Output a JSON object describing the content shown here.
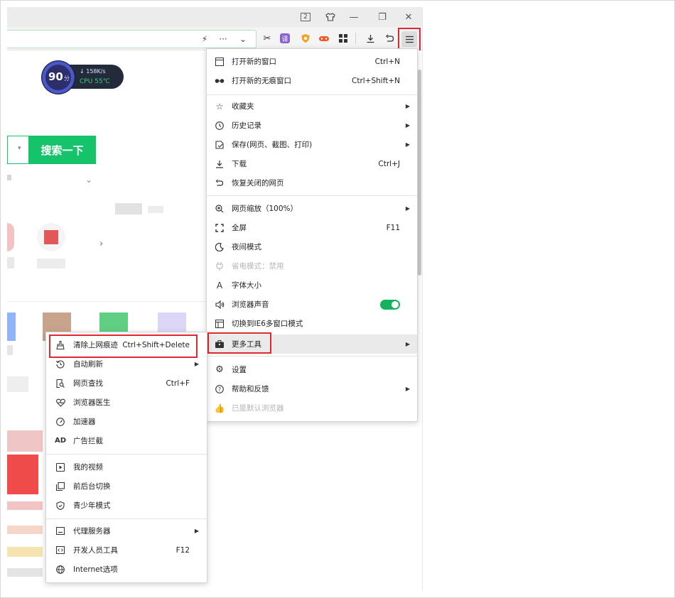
{
  "titlebar": {
    "tab_count": "2",
    "skin_icon": "tshirt-icon",
    "minimize_label": "—",
    "restore_label": "❐",
    "close_label": "✕"
  },
  "address_bar": {
    "bolt_icon": "⚡",
    "more_icon": "···",
    "chevron_icon": "⌄"
  },
  "toolbar_icons": {
    "translate_label": "译"
  },
  "widget": {
    "score": "90",
    "score_unit": "分",
    "speed": "↓ 158K/s",
    "cpu": "CPU 55℃"
  },
  "search": {
    "button_label": "搜索一下"
  },
  "main_menu": {
    "items": [
      {
        "label": "打开新的窗口",
        "shortcut": "Ctrl+N",
        "icon": "new-window-icon"
      },
      {
        "label": "打开新的无痕窗口",
        "shortcut": "Ctrl+Shift+N",
        "icon": "incognito-icon"
      },
      {
        "label": "收藏夹",
        "icon": "star-list-icon"
      },
      {
        "label": "历史记录",
        "icon": "clock-icon"
      },
      {
        "label": "保存(网页、截图、打印)",
        "icon": "save-icon"
      },
      {
        "label": "下载",
        "shortcut": "Ctrl+J",
        "icon": "download-icon"
      },
      {
        "label": "恢复关闭的网页",
        "icon": "undo-icon"
      },
      {
        "label": "网页缩放（100%）",
        "icon": "zoom-icon"
      },
      {
        "label": "全屏",
        "shortcut": "F11",
        "icon": "fullscreen-icon"
      },
      {
        "label": "夜间模式",
        "icon": "moon-icon"
      },
      {
        "label": "省电模式：禁用",
        "icon": "plug-icon"
      },
      {
        "label": "字体大小",
        "icon": "font-icon"
      },
      {
        "label": "浏览器声音",
        "icon": "speaker-icon"
      },
      {
        "label": "切换到IE6多窗口模式",
        "icon": "ie-window-icon"
      },
      {
        "label": "更多工具",
        "icon": "toolbox-icon"
      },
      {
        "label": "设置",
        "icon": "gear-icon"
      },
      {
        "label": "帮助和反馈",
        "icon": "help-icon"
      },
      {
        "label": "已是默认浏览器",
        "icon": "thumbs-up-icon"
      }
    ]
  },
  "sub_menu": {
    "items": [
      {
        "label": "清除上网痕迹",
        "shortcut": "Ctrl+Shift+Delete",
        "icon": "broom-icon"
      },
      {
        "label": "自动刷新",
        "icon": "refresh-clock-icon"
      },
      {
        "label": "网页查找",
        "shortcut": "Ctrl+F",
        "icon": "find-icon"
      },
      {
        "label": "浏览器医生",
        "icon": "heart-pulse-icon"
      },
      {
        "label": "加速器",
        "icon": "speedometer-icon"
      },
      {
        "label": "广告拦截",
        "icon": "ad-block-icon"
      },
      {
        "label": "我的视频",
        "icon": "video-icon"
      },
      {
        "label": "前后台切换",
        "icon": "switch-icon"
      },
      {
        "label": "青少年模式",
        "icon": "shield-icon"
      },
      {
        "label": "代理服务器",
        "icon": "proxy-icon"
      },
      {
        "label": "开发人员工具",
        "shortcut": "F12",
        "icon": "code-icon"
      },
      {
        "label": "Internet选项",
        "icon": "globe-icon"
      }
    ]
  },
  "colors": {
    "accent_green": "#15c36a",
    "highlight_red": "#e0282e",
    "toggle_on": "#15b35f"
  }
}
